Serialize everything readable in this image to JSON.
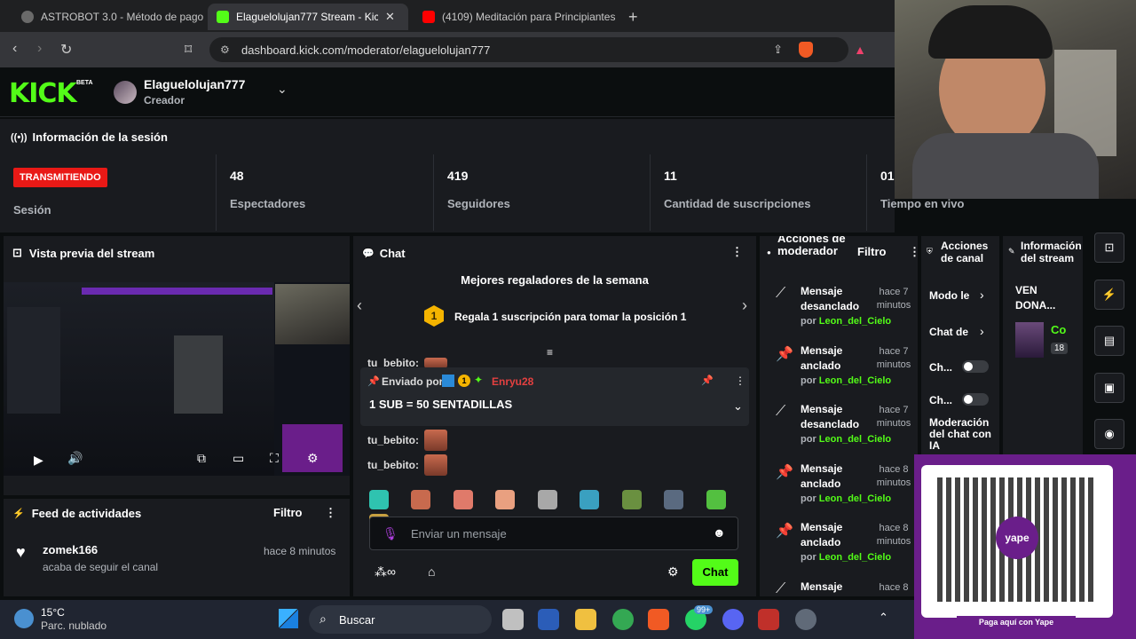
{
  "browser": {
    "tabs": [
      {
        "title": "ASTROBOT 3.0 - Método de pago Ast",
        "color": "#5a5a5a"
      },
      {
        "title": "Elaguelolujan777 Stream - Kick D",
        "color": "#53fc18"
      },
      {
        "title": "(4109) Meditación para Principiantes",
        "color": "#ff0000"
      }
    ],
    "url": "dashboard.kick.com/moderator/elaguelolujan777"
  },
  "header": {
    "logo": "KICK",
    "beta": "BETA",
    "username": "Elaguelolujan777",
    "role": "Creador"
  },
  "session": {
    "title": "Información de la sesión",
    "badge": "TRANSMITIENDO",
    "badge_label": "Sesión",
    "stats": [
      {
        "value": "48",
        "label": "Espectadores"
      },
      {
        "value": "419",
        "label": "Seguidores"
      },
      {
        "value": "11",
        "label": "Cantidad de suscripciones"
      },
      {
        "value": "01",
        "label": "Tiempo en vivo"
      }
    ]
  },
  "preview": {
    "title": "Vista previa del stream"
  },
  "feed": {
    "title": "Feed de actividades",
    "filter": "Filtro",
    "items": [
      {
        "user": "zomek166",
        "action": "acaba de seguir el canal",
        "time": "hace 8 minutos"
      }
    ]
  },
  "chat": {
    "title": "Chat",
    "gifters_title": "Mejores regaladores de la semana",
    "gifters_rank": "1",
    "gifters_text": "Regala 1 suscripción para tomar la posición 1",
    "pinned_by_label": "Enviado por",
    "pinned_user": "Enryu28",
    "pinned_badge": "1",
    "pinned_message": "1 SUB = 50 SENTADILLAS",
    "messages": [
      {
        "user": "tu_bebito:"
      },
      {
        "user": "tu_bebito:"
      },
      {
        "user": "tu_bebito:"
      }
    ],
    "input_placeholder": "Enviar un mensaje",
    "send_button": "Chat"
  },
  "mod_actions": {
    "title": "Acciones de moderador",
    "filter": "Filtro",
    "by_prefix": "por",
    "items": [
      {
        "action": "Mensaje desanclado",
        "time": "hace 7 minutos",
        "by": "Leon_del_Cielo",
        "icon": "unpin-icon"
      },
      {
        "action": "Mensaje anclado",
        "time": "hace 7 minutos",
        "by": "Leon_del_Cielo",
        "icon": "pin-icon"
      },
      {
        "action": "Mensaje desanclado",
        "time": "hace 7 minutos",
        "by": "Leon_del_Cielo",
        "icon": "unpin-icon"
      },
      {
        "action": "Mensaje anclado",
        "time": "hace 8 minutos",
        "by": "Leon_del_Cielo",
        "icon": "pin-icon"
      },
      {
        "action": "Mensaje anclado",
        "time": "hace 8 minutos",
        "by": "Leon_del_Cielo",
        "icon": "pin-icon"
      },
      {
        "action": "Mensaje",
        "time": "hace 8",
        "by": "",
        "icon": "unpin-icon"
      }
    ]
  },
  "channel_actions": {
    "title": "Acciones de canal",
    "items": [
      "Modo le",
      "Chat de",
      "Ch...",
      "Ch...",
      "Moderación del chat con IA"
    ]
  },
  "stream_info": {
    "title": "Información del stream",
    "text": "VEN DONA...",
    "category": "Co",
    "count": "18"
  },
  "taskbar": {
    "temp": "15°C",
    "weather": "Parc. nublado",
    "search": "Buscar",
    "badge": "99+"
  },
  "qr": {
    "caption": "Paga aquí con Yape",
    "brand": "yape"
  }
}
